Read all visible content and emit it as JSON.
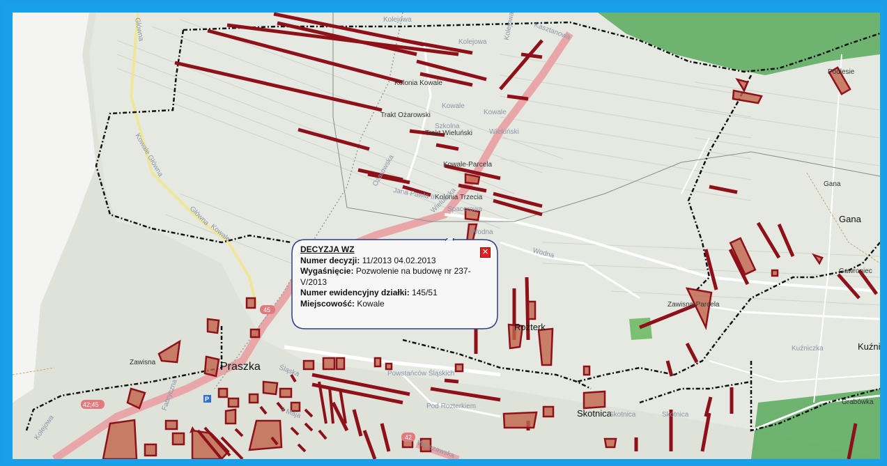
{
  "popup": {
    "title": "DECYZJA WZ",
    "fields": [
      {
        "label": "Numer decyzji:",
        "value": "11/2013 04.02.2013"
      },
      {
        "label": "Wygaśnięcie:",
        "value": "Pozwolenie na budowę nr 237-V/2013"
      },
      {
        "label": "Numer ewidencyjny działki:",
        "value": "145/51"
      },
      {
        "label": "Miejscowość:",
        "value": "Kowale"
      }
    ],
    "close_icon": "close-icon"
  },
  "map": {
    "places": {
      "praszka": "Praszka",
      "rozterk": "Rozterk",
      "skotnica": "Skotnica",
      "skotnica_faint": "Skotnica",
      "gana": "Gana",
      "gana_faint": "Gana",
      "kuznica": "Kuźni",
      "kuzniczka": "Kuźniczka",
      "grabowka": "Grabówka",
      "gawroniec": "Gawroniec",
      "podlesie": "Podlesie",
      "zawisna": "Zawisna",
      "zawisna_parcela": "Zawisna-Parcela",
      "kolonia_kowale": "Kolonia Kowale",
      "trakt_ozarowski": "Trakt Ożarowski",
      "kowale": "Kowale",
      "trakt_wielunski": "Trakt Wieluński",
      "kowale_parcela": "Kowale-Parcela",
      "kolonia_trzecia": "Kolonia Trzecia"
    },
    "streets": {
      "kolejowa1": "Kolejowa",
      "kolejowa2": "Kolejowa",
      "kolejowa3": "Kolejowa",
      "kasztanowa": "Kasztanowa",
      "glowna1": "Główna",
      "glowna2": "Kowale Główna",
      "glowna3": "Główna",
      "kowale_road": "Kowale",
      "szkolna": "Szkolna",
      "jana_pawla": "Jana Pawła II",
      "ozarowska": "Ożarowska",
      "spacerowa": "Spacerowa",
      "wodna1": "Wodna",
      "wodna2": "Wodna",
      "wielunska": "Wieluńska",
      "powstancow": "Powstańców Śląskich",
      "pod_rozterkiem": "Pod Rozterkiem",
      "warszawska": "Warszawska",
      "slaska": "Śląska",
      "fabryczna": "Fabryczna",
      "maja": "3 Maja",
      "kolejowa_s": "Kolejowa",
      "rozerk": "Rozerk",
      "wielunski_faint": "Wieluński"
    },
    "road_numbers": {
      "r45": "45",
      "r4245": "42;45",
      "r42": "42"
    },
    "parking_symbol": "P",
    "colors": {
      "parcel": "#8e1019",
      "parcel_fill": "#c0634a",
      "boundary": "#111111",
      "forest": "#3f9a45",
      "road_main": "#e8a0a2",
      "frame": "#1a9ee8"
    }
  }
}
